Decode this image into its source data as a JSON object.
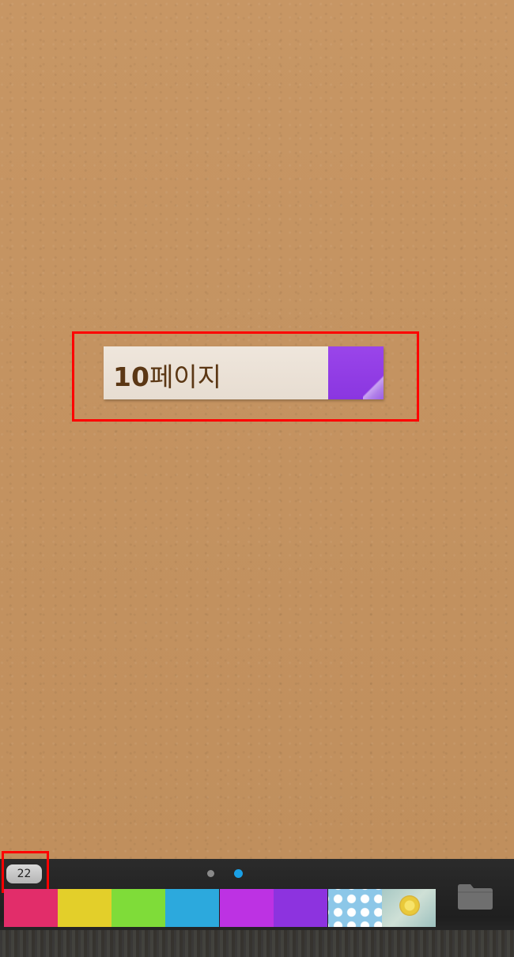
{
  "note": {
    "number": "10",
    "label": "페이지",
    "tab_color": "#8f3de6"
  },
  "bottom_bar": {
    "note_count": "22",
    "pages": {
      "total": 2,
      "current": 2
    },
    "active_dot_color": "#1aa0e6",
    "swatches": [
      {
        "name": "pink",
        "color": "#e22d6a"
      },
      {
        "name": "yellow",
        "color": "#e3cf2a"
      },
      {
        "name": "green",
        "color": "#7fdc39"
      },
      {
        "name": "blue",
        "color": "#2ca9dd"
      },
      {
        "name": "magenta",
        "color": "#bd32e3"
      },
      {
        "name": "purple",
        "color": "#8d33df"
      },
      {
        "name": "polka-dot",
        "color": "#8cc7e8"
      },
      {
        "name": "flower-pattern",
        "color": "#b7d2cc"
      }
    ],
    "folder_icon": "folder-icon"
  },
  "colors": {
    "board": "#c39261",
    "highlight": "#ff0000"
  }
}
